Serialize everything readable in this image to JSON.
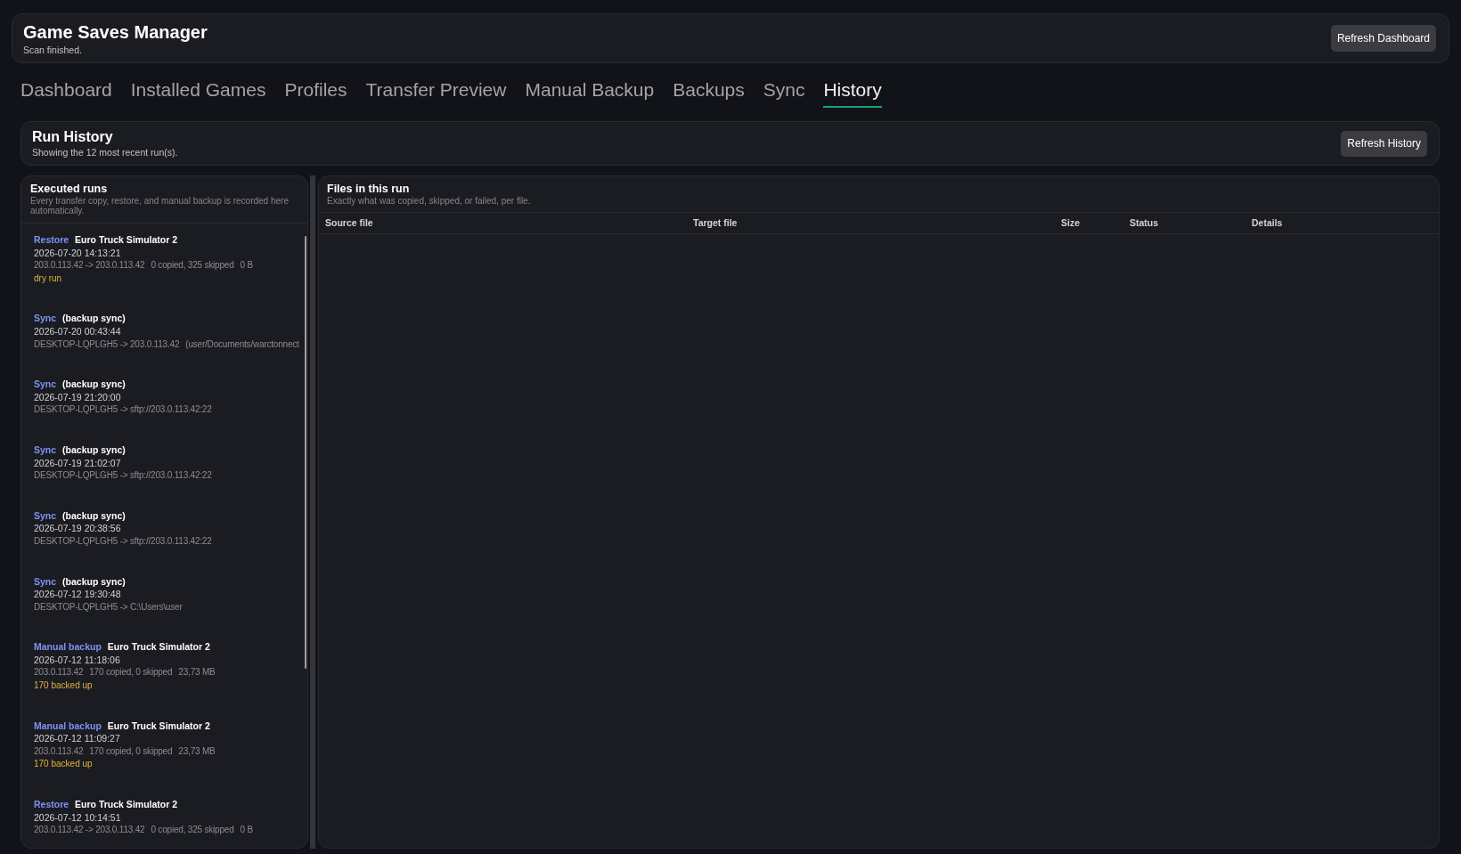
{
  "header": {
    "title": "Game Saves Manager",
    "status": "Scan finished.",
    "button": "Refresh Dashboard"
  },
  "tabs": [
    {
      "label": "Dashboard",
      "selected": false
    },
    {
      "label": "Installed Games",
      "selected": false
    },
    {
      "label": "Profiles",
      "selected": false
    },
    {
      "label": "Transfer Preview",
      "selected": false
    },
    {
      "label": "Manual Backup",
      "selected": false
    },
    {
      "label": "Backups",
      "selected": false
    },
    {
      "label": "Sync",
      "selected": false
    },
    {
      "label": "History",
      "selected": true
    }
  ],
  "run_history": {
    "title": "Run History",
    "subtitle": "Showing the 12 most recent run(s).",
    "button": "Refresh History"
  },
  "executed_runs": {
    "title": "Executed runs",
    "description": "Every transfer copy, restore, and manual backup is recorded here automatically.",
    "runs": [
      {
        "type": "Restore",
        "subject": "Euro Truck Simulator 2",
        "time": "2026-07-20 14:13:21",
        "details": [
          "203.0.113.42 -> 203.0.113.42",
          "0 copied, 325 skipped",
          "0 B"
        ],
        "note": "dry run"
      },
      {
        "type": "Sync",
        "subject": "(backup sync)",
        "time": "2026-07-20 00:43:44",
        "details": [
          "DESKTOP-LQPLGH5 -> 203.0.113.42",
          "(user/Documents/warctonnect"
        ]
      },
      {
        "type": "Sync",
        "subject": "(backup sync)",
        "time": "2026-07-19 21:20:00",
        "details": [
          "DESKTOP-LQPLGH5 -> sftp://203.0.113.42:22"
        ]
      },
      {
        "type": "Sync",
        "subject": "(backup sync)",
        "time": "2026-07-19 21:02:07",
        "details": [
          "DESKTOP-LQPLGH5 -> sftp://203.0.113.42:22"
        ]
      },
      {
        "type": "Sync",
        "subject": "(backup sync)",
        "time": "2026-07-19 20:38:56",
        "details": [
          "DESKTOP-LQPLGH5 -> sftp://203.0.113.42:22"
        ]
      },
      {
        "type": "Sync",
        "subject": "(backup sync)",
        "time": "2026-07-12 19:30:48",
        "details": [
          "DESKTOP-LQPLGH5 -> C:\\Users\\user"
        ]
      },
      {
        "type": "Manual backup",
        "subject": "Euro Truck Simulator 2",
        "time": "2026-07-12 11:18:06",
        "details": [
          "203.0.113.42",
          "170 copied, 0 skipped",
          "23,73 MB"
        ],
        "note": "170 backed up"
      },
      {
        "type": "Manual backup",
        "subject": "Euro Truck Simulator 2",
        "time": "2026-07-12 11:09:27",
        "details": [
          "203.0.113.42",
          "170 copied, 0 skipped",
          "23,73 MB"
        ],
        "note": "170 backed up"
      },
      {
        "type": "Restore",
        "subject": "Euro Truck Simulator 2",
        "time": "2026-07-12 10:14:51",
        "details": [
          "203.0.113.42 -> 203.0.113.42",
          "0 copied, 325 skipped",
          "0 B"
        ]
      }
    ]
  },
  "files_in_run": {
    "title": "Files in this run",
    "description": "Exactly what was copied, skipped, or failed, per file.",
    "table": {
      "columns": [
        "Source file",
        "Target file",
        "Size",
        "Status",
        "Details"
      ]
    }
  }
}
